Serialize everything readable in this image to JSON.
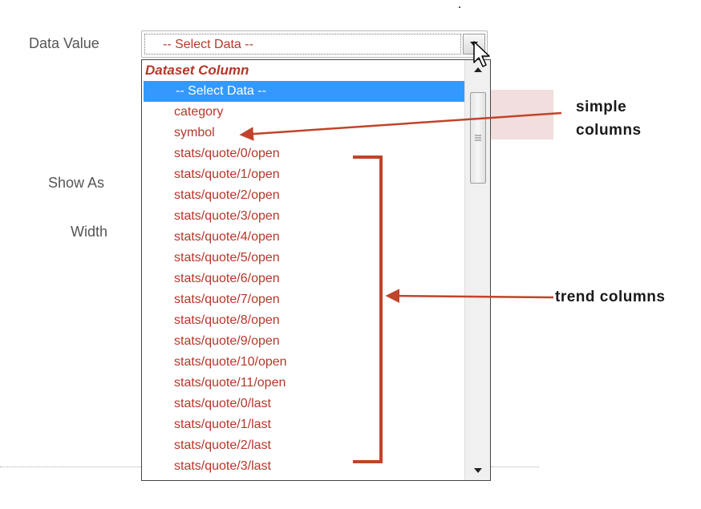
{
  "form": {
    "data_value_label": "Data Value",
    "show_as_label": "Show As",
    "width_label": "Width",
    "select_value": "-- Select Data --"
  },
  "dropdown": {
    "group_label": "Dataset Column",
    "selected_option": "-- Select Data --",
    "options": [
      "category",
      "symbol",
      "stats/quote/0/open",
      "stats/quote/1/open",
      "stats/quote/2/open",
      "stats/quote/3/open",
      "stats/quote/4/open",
      "stats/quote/5/open",
      "stats/quote/6/open",
      "stats/quote/7/open",
      "stats/quote/8/open",
      "stats/quote/9/open",
      "stats/quote/10/open",
      "stats/quote/11/open",
      "stats/quote/0/last",
      "stats/quote/1/last",
      "stats/quote/2/last",
      "stats/quote/3/last"
    ]
  },
  "annotations": {
    "simple_columns_line1": "simple",
    "simple_columns_line2": "columns",
    "trend_columns": "trend columns"
  },
  "colors": {
    "option_text": "#b5372a",
    "selected_bg": "#3399ff",
    "annotation_arrow": "#c0442a"
  },
  "icons": {
    "dropdown_arrow": "chevron-down-icon",
    "cursor": "mouse-pointer-icon",
    "scroll_up": "scroll-up-icon",
    "scroll_down": "scroll-down-icon"
  }
}
